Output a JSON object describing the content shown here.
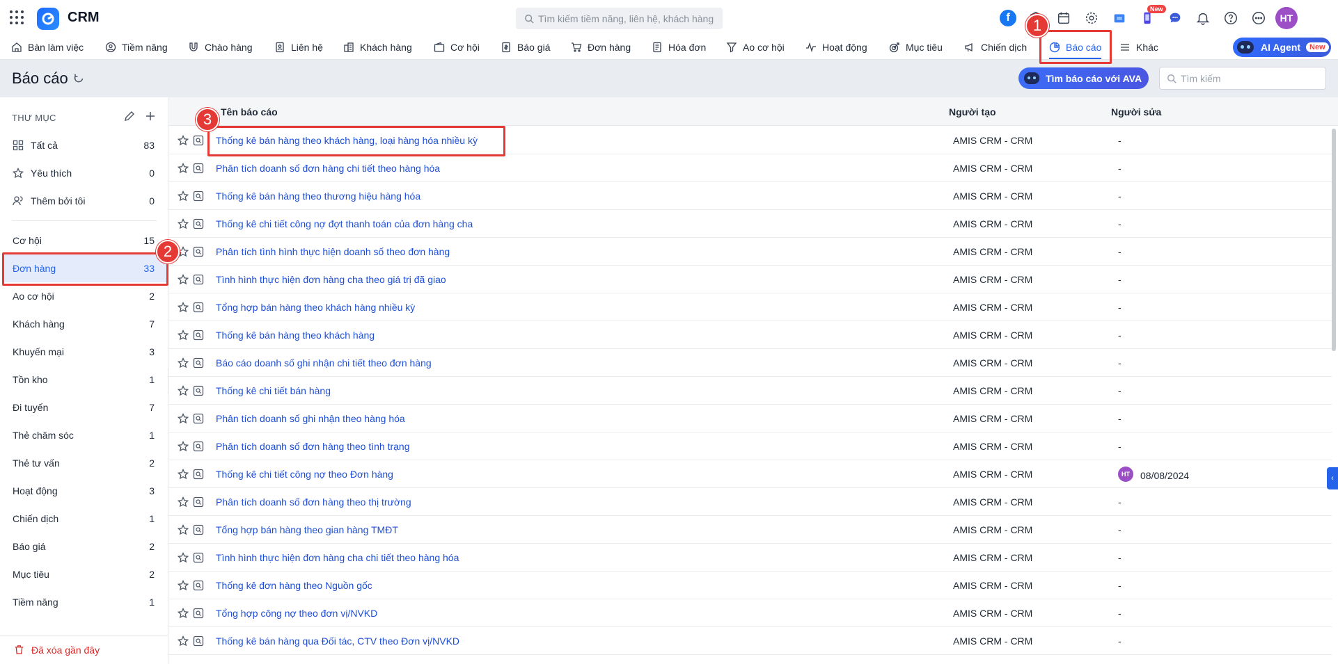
{
  "app": {
    "name": "CRM"
  },
  "search_top": {
    "placeholder": "Tìm kiếm tiềm năng, liên hệ, khách hàng"
  },
  "top_icons": {
    "new_badge": "New",
    "avatar": "HT",
    "facebook": "f"
  },
  "nav": {
    "items": [
      {
        "label": "Bàn làm việc",
        "icon": "home-icon"
      },
      {
        "label": "Tiềm năng",
        "icon": "user-circle-icon"
      },
      {
        "label": "Chào hàng",
        "icon": "magnet-icon"
      },
      {
        "label": "Liên hệ",
        "icon": "contact-card-icon"
      },
      {
        "label": "Khách hàng",
        "icon": "building-icon"
      },
      {
        "label": "Cơ hội",
        "icon": "wallet-icon"
      },
      {
        "label": "Báo giá",
        "icon": "quote-doc-icon"
      },
      {
        "label": "Đơn hàng",
        "icon": "cart-icon"
      },
      {
        "label": "Hóa đơn",
        "icon": "invoice-icon"
      },
      {
        "label": "Ao cơ hội",
        "icon": "funnel-icon"
      },
      {
        "label": "Hoạt động",
        "icon": "activity-icon"
      },
      {
        "label": "Mục tiêu",
        "icon": "target-icon"
      },
      {
        "label": "Chiến dịch",
        "icon": "megaphone-icon"
      },
      {
        "label": "Báo cáo",
        "icon": "pie-chart-icon"
      },
      {
        "label": "Khác",
        "icon": "menu-icon"
      }
    ],
    "active": "Báo cáo",
    "ai_agent": {
      "label": "AI Agent",
      "badge": "New"
    }
  },
  "page": {
    "title": "Báo cáo",
    "ava_button": "Tìm báo cáo với AVA",
    "search_placeholder": "Tìm kiếm"
  },
  "sidebar": {
    "heading": "THƯ MỤC",
    "top_items": [
      {
        "label": "Tất cả",
        "count": "83",
        "icon": "grid-icon"
      },
      {
        "label": "Yêu thích",
        "count": "0",
        "icon": "star-icon"
      },
      {
        "label": "Thêm bởi tôi",
        "count": "0",
        "icon": "user-icon"
      }
    ],
    "folders": [
      {
        "label": "Cơ hội",
        "count": "15"
      },
      {
        "label": "Đơn hàng",
        "count": "33"
      },
      {
        "label": "Ao cơ hội",
        "count": "2"
      },
      {
        "label": "Khách hàng",
        "count": "7"
      },
      {
        "label": "Khuyến mại",
        "count": "3"
      },
      {
        "label": "Tồn kho",
        "count": "1"
      },
      {
        "label": "Đi tuyến",
        "count": "7"
      },
      {
        "label": "Thẻ chăm sóc",
        "count": "1"
      },
      {
        "label": "Thẻ tư vấn",
        "count": "2"
      },
      {
        "label": "Hoạt động",
        "count": "3"
      },
      {
        "label": "Chiến dịch",
        "count": "1"
      },
      {
        "label": "Báo giá",
        "count": "2"
      },
      {
        "label": "Mục tiêu",
        "count": "2"
      },
      {
        "label": "Tiềm năng",
        "count": "1"
      }
    ],
    "active_folder": "Đơn hàng",
    "recently_deleted": "Đã xóa gần đây"
  },
  "table": {
    "headers": {
      "name": "Tên báo cáo",
      "creator": "Người tạo",
      "editor": "Người sửa"
    },
    "rows": [
      {
        "name": "Thống kê bán hàng theo khách hàng, loại hàng hóa nhiều kỳ",
        "creator": "AMIS CRM - CRM",
        "editor": "-"
      },
      {
        "name": "Phân tích doanh số đơn hàng chi tiết theo hàng hóa",
        "creator": "AMIS CRM - CRM",
        "editor": "-"
      },
      {
        "name": "Thống kê bán hàng theo thương hiệu hàng hóa",
        "creator": "AMIS CRM - CRM",
        "editor": "-"
      },
      {
        "name": "Thống kê chi tiết công nợ đợt thanh toán của đơn hàng cha",
        "creator": "AMIS CRM - CRM",
        "editor": "-"
      },
      {
        "name": "Phân tích tình hình thực hiện doanh số theo đơn hàng",
        "creator": "AMIS CRM - CRM",
        "editor": "-"
      },
      {
        "name": "Tình hình thực hiện đơn hàng cha theo giá trị đã giao",
        "creator": "AMIS CRM - CRM",
        "editor": "-"
      },
      {
        "name": "Tổng hợp bán hàng theo khách hàng nhiều kỳ",
        "creator": "AMIS CRM - CRM",
        "editor": "-"
      },
      {
        "name": "Thống kê bán hàng theo khách hàng",
        "creator": "AMIS CRM - CRM",
        "editor": "-"
      },
      {
        "name": "Báo cáo doanh số ghi nhận chi tiết theo đơn hàng",
        "creator": "AMIS CRM - CRM",
        "editor": "-"
      },
      {
        "name": "Thống kê chi tiết bán hàng",
        "creator": "AMIS CRM - CRM",
        "editor": "-"
      },
      {
        "name": "Phân tích doanh số ghi nhận theo hàng hóa",
        "creator": "AMIS CRM - CRM",
        "editor": "-"
      },
      {
        "name": "Phân tích doanh số đơn hàng theo tình trạng",
        "creator": "AMIS CRM - CRM",
        "editor": "-"
      },
      {
        "name": "Thống kê chi tiết công nợ theo Đơn hàng",
        "creator": "AMIS CRM - CRM",
        "editor": "08/08/2024",
        "editor_avatar": "HT"
      },
      {
        "name": "Phân tích doanh số đơn hàng theo thị trường",
        "creator": "AMIS CRM - CRM",
        "editor": "-"
      },
      {
        "name": "Tổng hợp bán hàng theo gian hàng TMĐT",
        "creator": "AMIS CRM - CRM",
        "editor": "-"
      },
      {
        "name": "Tình hình thực hiện đơn hàng cha chi tiết theo hàng hóa",
        "creator": "AMIS CRM - CRM",
        "editor": "-"
      },
      {
        "name": "Thống kê đơn hàng theo Nguồn gốc",
        "creator": "AMIS CRM - CRM",
        "editor": "-"
      },
      {
        "name": "Tổng hợp công nợ theo đơn vị/NVKD",
        "creator": "AMIS CRM - CRM",
        "editor": "-"
      },
      {
        "name": "Thống kê bán hàng qua Đối tác, CTV theo Đơn vị/NVKD",
        "creator": "AMIS CRM - CRM",
        "editor": "-"
      }
    ]
  },
  "callouts": [
    "1",
    "2",
    "3"
  ],
  "colors": {
    "accent": "#2563eb",
    "highlight": "#e53935",
    "link": "#1d4ed8"
  }
}
